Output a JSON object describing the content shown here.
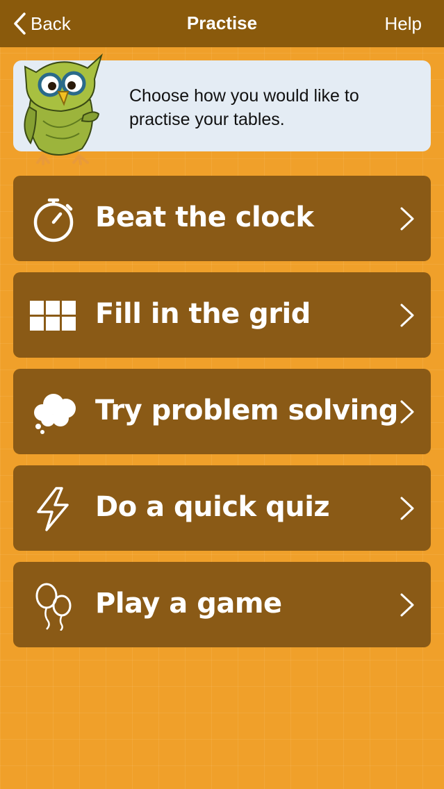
{
  "nav": {
    "back_label": "Back",
    "title": "Practise",
    "help_label": "Help"
  },
  "intro": {
    "text": "Choose how you would like to practise your tables."
  },
  "menu": [
    {
      "label": "Beat the clock",
      "icon": "stopwatch-icon"
    },
    {
      "label": "Fill in the grid",
      "icon": "grid-icon"
    },
    {
      "label": "Try problem solving",
      "icon": "thought-cloud-icon"
    },
    {
      "label": "Do a quick quiz",
      "icon": "lightning-icon"
    },
    {
      "label": "Play a game",
      "icon": "balloons-icon"
    }
  ],
  "colors": {
    "background": "#f0a02a",
    "navbar": "#8a5a0c",
    "button": "#8a5a16",
    "intro_bg": "#e4ecf4"
  }
}
